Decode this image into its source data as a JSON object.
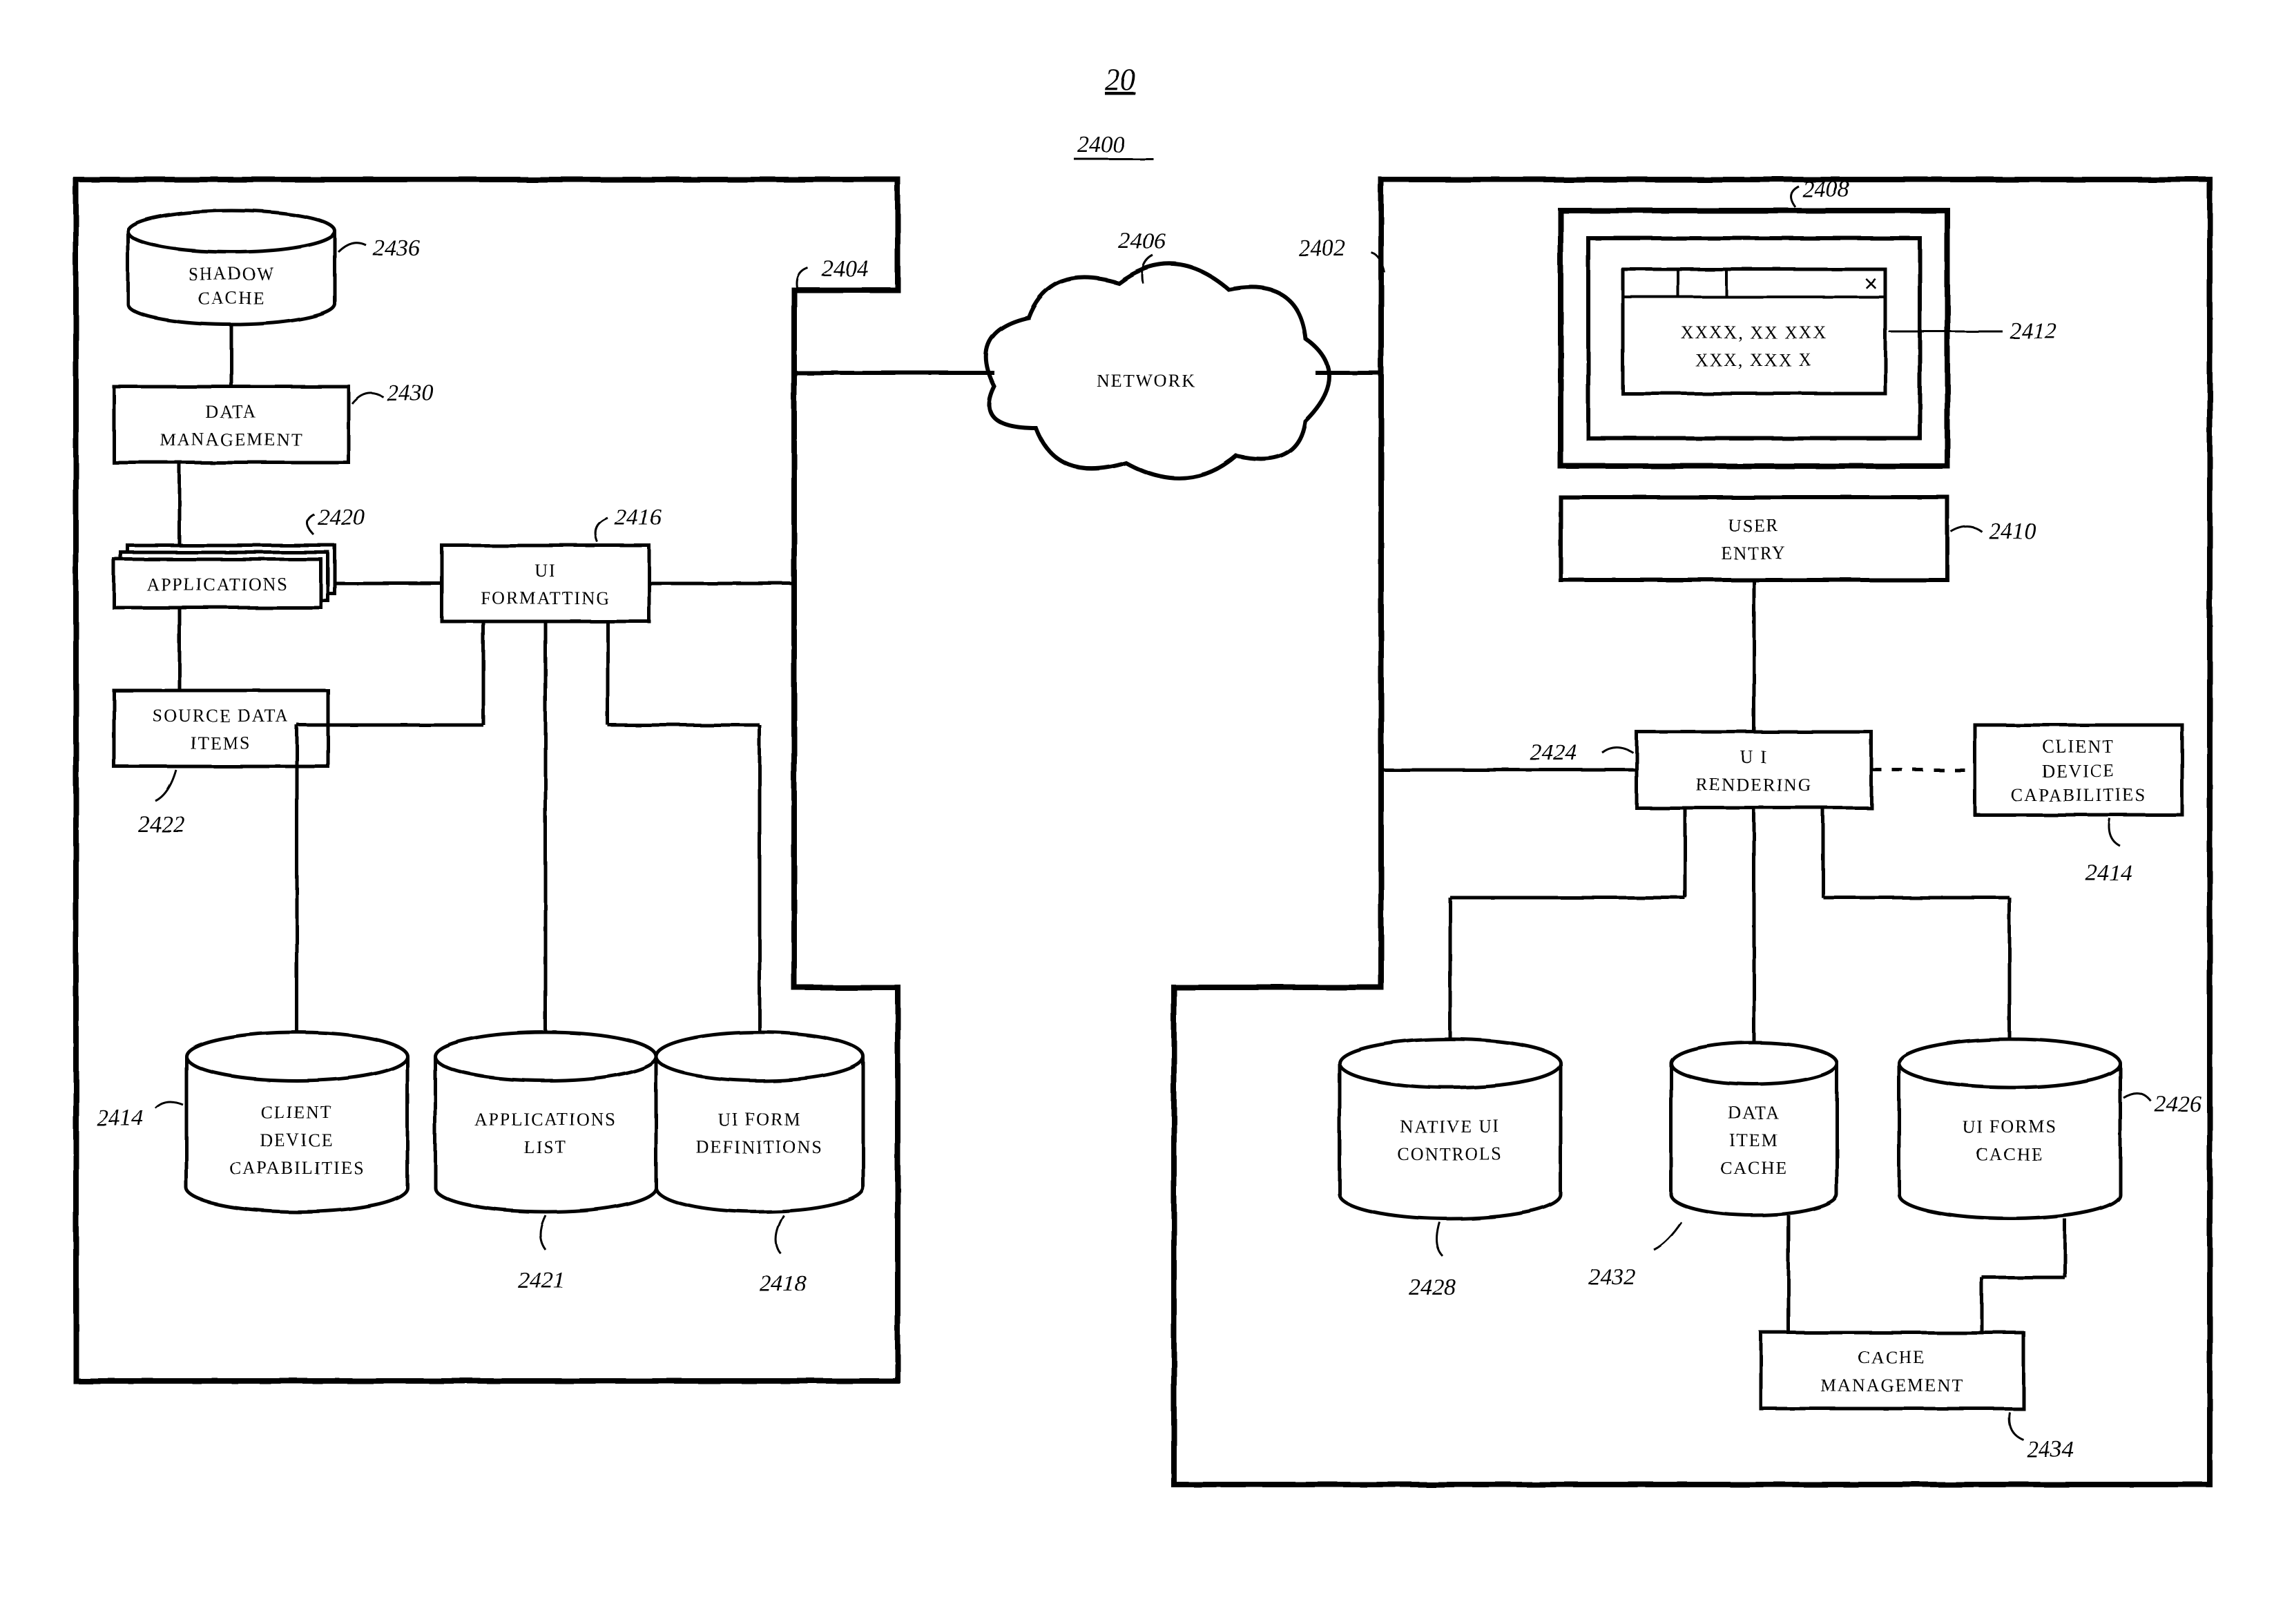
{
  "figure_number": "20",
  "system_ref": "2400",
  "network": {
    "label": "NETWORK",
    "ref": "2406"
  },
  "server": {
    "ref": "2404",
    "shadow_cache": {
      "label_top": "SHADOW",
      "label_bot": "CACHE",
      "ref": "2436"
    },
    "data_mgmt": {
      "label_top": "DATA",
      "label_bot": "MANAGEMENT",
      "ref": "2430"
    },
    "applications": {
      "label": "APPLICATIONS",
      "ref": "2420"
    },
    "ui_formatting": {
      "label_top": "UI",
      "label_bot": "FORMATTING",
      "ref": "2416"
    },
    "source_items": {
      "label_top": "SOURCE DATA",
      "label_bot": "ITEMS",
      "ref": "2422"
    },
    "client_caps": {
      "label_top": "CLIENT",
      "label_mid": "DEVICE",
      "label_bot": "CAPABILITIES",
      "ref": "2414"
    },
    "apps_list": {
      "label_top": "APPLICATIONS",
      "label_bot": "LIST",
      "ref": "2421"
    },
    "ui_form_defs": {
      "label_top": "UI FORM",
      "label_bot": "DEFINITIONS",
      "ref": "2418"
    }
  },
  "client": {
    "ref": "2402",
    "display": {
      "ref": "2408",
      "screen_content_ref": "2412",
      "content_l1": "XXXX, XX XXX",
      "content_l2": "XXX, XXX X"
    },
    "user_entry": {
      "label_top": "USER",
      "label_bot": "ENTRY",
      "ref": "2410"
    },
    "ui_rendering": {
      "label_top": "U I",
      "label_bot": "RENDERING",
      "ref": "2424"
    },
    "client_caps": {
      "label_top": "CLIENT",
      "label_mid": "DEVICE",
      "label_bot": "CAPABILITIES",
      "ref": "2414"
    },
    "native_ctrls": {
      "label_top": "NATIVE UI",
      "label_bot": "CONTROLS",
      "ref": "2428"
    },
    "data_cache": {
      "label_top": "DATA",
      "label_mid": "ITEM",
      "label_bot": "CACHE",
      "ref": "2432"
    },
    "forms_cache": {
      "label_top": "UI FORMS",
      "label_bot": "CACHE",
      "ref": "2426"
    },
    "cache_mgmt": {
      "label_top": "CACHE",
      "label_bot": "MANAGEMENT",
      "ref": "2434"
    }
  }
}
